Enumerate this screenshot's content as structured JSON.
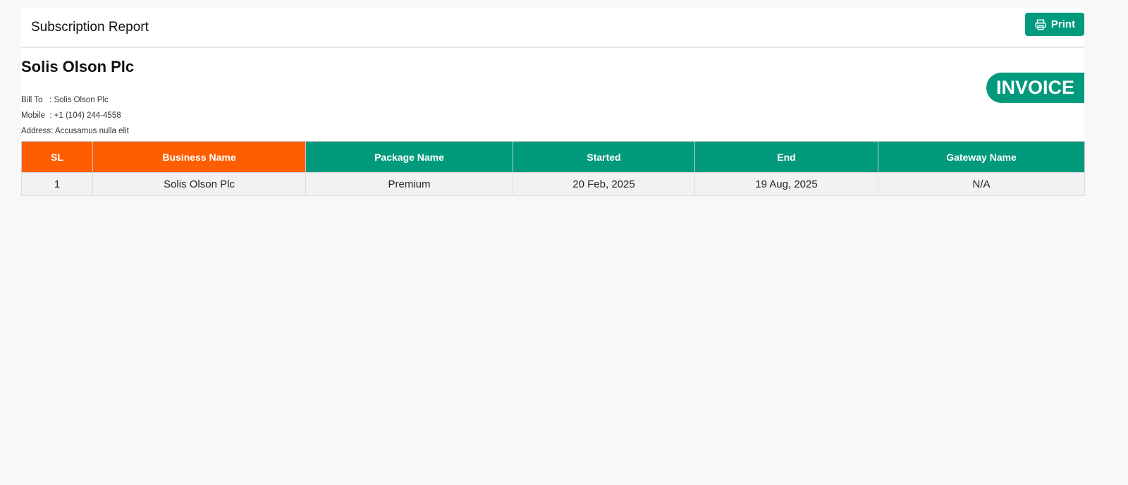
{
  "header": {
    "title": "Subscription Report",
    "print_label": "Print"
  },
  "company": "Solis Olson Plc",
  "bill_to": {
    "label": "Bill To",
    "value": "Solis Olson Plc"
  },
  "mobile": {
    "label": "Mobile",
    "value": "+1 (104) 244-4558"
  },
  "address": {
    "label": "Address",
    "value": "Accusamus nulla elit"
  },
  "badge": "INVOICE",
  "table": {
    "columns": [
      "SL",
      "Business Name",
      "Package Name",
      "Started",
      "End",
      "Gateway Name"
    ],
    "rows": [
      [
        "1",
        "Solis Olson Plc",
        "Premium",
        "20 Feb, 2025",
        "19 Aug, 2025",
        "N/A"
      ]
    ]
  },
  "colors": {
    "accent": "#019a7c",
    "orange": "#fe5d00"
  }
}
